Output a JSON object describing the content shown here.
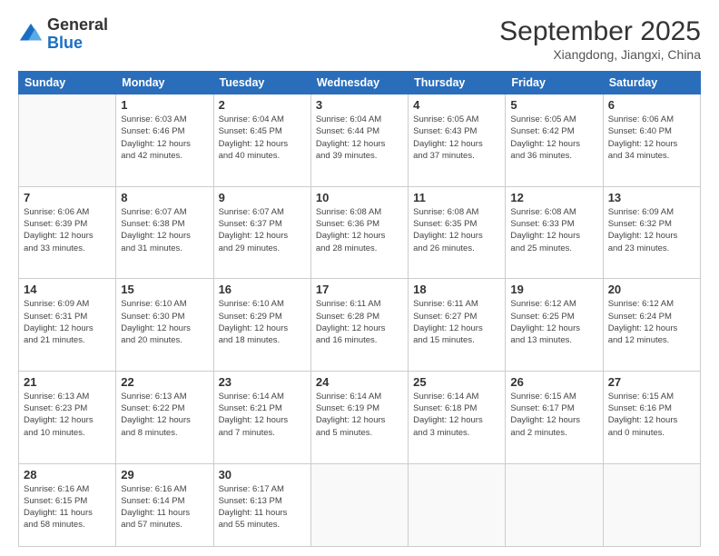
{
  "logo": {
    "general": "General",
    "blue": "Blue"
  },
  "header": {
    "month": "September 2025",
    "location": "Xiangdong, Jiangxi, China"
  },
  "weekdays": [
    "Sunday",
    "Monday",
    "Tuesday",
    "Wednesday",
    "Thursday",
    "Friday",
    "Saturday"
  ],
  "weeks": [
    [
      {
        "day": "",
        "info": ""
      },
      {
        "day": "1",
        "info": "Sunrise: 6:03 AM\nSunset: 6:46 PM\nDaylight: 12 hours\nand 42 minutes."
      },
      {
        "day": "2",
        "info": "Sunrise: 6:04 AM\nSunset: 6:45 PM\nDaylight: 12 hours\nand 40 minutes."
      },
      {
        "day": "3",
        "info": "Sunrise: 6:04 AM\nSunset: 6:44 PM\nDaylight: 12 hours\nand 39 minutes."
      },
      {
        "day": "4",
        "info": "Sunrise: 6:05 AM\nSunset: 6:43 PM\nDaylight: 12 hours\nand 37 minutes."
      },
      {
        "day": "5",
        "info": "Sunrise: 6:05 AM\nSunset: 6:42 PM\nDaylight: 12 hours\nand 36 minutes."
      },
      {
        "day": "6",
        "info": "Sunrise: 6:06 AM\nSunset: 6:40 PM\nDaylight: 12 hours\nand 34 minutes."
      }
    ],
    [
      {
        "day": "7",
        "info": "Sunrise: 6:06 AM\nSunset: 6:39 PM\nDaylight: 12 hours\nand 33 minutes."
      },
      {
        "day": "8",
        "info": "Sunrise: 6:07 AM\nSunset: 6:38 PM\nDaylight: 12 hours\nand 31 minutes."
      },
      {
        "day": "9",
        "info": "Sunrise: 6:07 AM\nSunset: 6:37 PM\nDaylight: 12 hours\nand 29 minutes."
      },
      {
        "day": "10",
        "info": "Sunrise: 6:08 AM\nSunset: 6:36 PM\nDaylight: 12 hours\nand 28 minutes."
      },
      {
        "day": "11",
        "info": "Sunrise: 6:08 AM\nSunset: 6:35 PM\nDaylight: 12 hours\nand 26 minutes."
      },
      {
        "day": "12",
        "info": "Sunrise: 6:08 AM\nSunset: 6:33 PM\nDaylight: 12 hours\nand 25 minutes."
      },
      {
        "day": "13",
        "info": "Sunrise: 6:09 AM\nSunset: 6:32 PM\nDaylight: 12 hours\nand 23 minutes."
      }
    ],
    [
      {
        "day": "14",
        "info": "Sunrise: 6:09 AM\nSunset: 6:31 PM\nDaylight: 12 hours\nand 21 minutes."
      },
      {
        "day": "15",
        "info": "Sunrise: 6:10 AM\nSunset: 6:30 PM\nDaylight: 12 hours\nand 20 minutes."
      },
      {
        "day": "16",
        "info": "Sunrise: 6:10 AM\nSunset: 6:29 PM\nDaylight: 12 hours\nand 18 minutes."
      },
      {
        "day": "17",
        "info": "Sunrise: 6:11 AM\nSunset: 6:28 PM\nDaylight: 12 hours\nand 16 minutes."
      },
      {
        "day": "18",
        "info": "Sunrise: 6:11 AM\nSunset: 6:27 PM\nDaylight: 12 hours\nand 15 minutes."
      },
      {
        "day": "19",
        "info": "Sunrise: 6:12 AM\nSunset: 6:25 PM\nDaylight: 12 hours\nand 13 minutes."
      },
      {
        "day": "20",
        "info": "Sunrise: 6:12 AM\nSunset: 6:24 PM\nDaylight: 12 hours\nand 12 minutes."
      }
    ],
    [
      {
        "day": "21",
        "info": "Sunrise: 6:13 AM\nSunset: 6:23 PM\nDaylight: 12 hours\nand 10 minutes."
      },
      {
        "day": "22",
        "info": "Sunrise: 6:13 AM\nSunset: 6:22 PM\nDaylight: 12 hours\nand 8 minutes."
      },
      {
        "day": "23",
        "info": "Sunrise: 6:14 AM\nSunset: 6:21 PM\nDaylight: 12 hours\nand 7 minutes."
      },
      {
        "day": "24",
        "info": "Sunrise: 6:14 AM\nSunset: 6:19 PM\nDaylight: 12 hours\nand 5 minutes."
      },
      {
        "day": "25",
        "info": "Sunrise: 6:14 AM\nSunset: 6:18 PM\nDaylight: 12 hours\nand 3 minutes."
      },
      {
        "day": "26",
        "info": "Sunrise: 6:15 AM\nSunset: 6:17 PM\nDaylight: 12 hours\nand 2 minutes."
      },
      {
        "day": "27",
        "info": "Sunrise: 6:15 AM\nSunset: 6:16 PM\nDaylight: 12 hours\nand 0 minutes."
      }
    ],
    [
      {
        "day": "28",
        "info": "Sunrise: 6:16 AM\nSunset: 6:15 PM\nDaylight: 11 hours\nand 58 minutes."
      },
      {
        "day": "29",
        "info": "Sunrise: 6:16 AM\nSunset: 6:14 PM\nDaylight: 11 hours\nand 57 minutes."
      },
      {
        "day": "30",
        "info": "Sunrise: 6:17 AM\nSunset: 6:13 PM\nDaylight: 11 hours\nand 55 minutes."
      },
      {
        "day": "",
        "info": ""
      },
      {
        "day": "",
        "info": ""
      },
      {
        "day": "",
        "info": ""
      },
      {
        "day": "",
        "info": ""
      }
    ]
  ]
}
